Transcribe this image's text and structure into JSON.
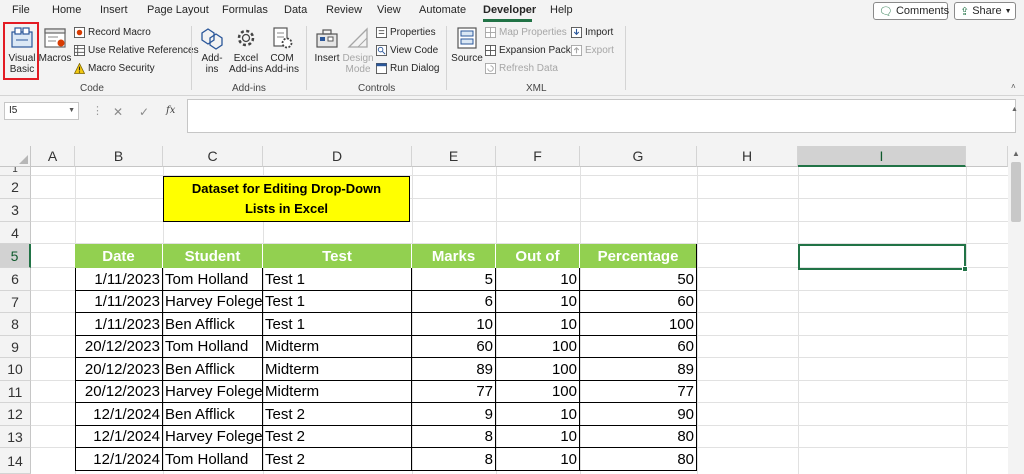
{
  "menu": {
    "tabs": [
      "File",
      "Home",
      "Insert",
      "Page Layout",
      "Formulas",
      "Data",
      "Review",
      "View",
      "Automate",
      "Developer",
      "Help"
    ],
    "active_tab": "Developer",
    "comments_label": "Comments",
    "share_label": "Share"
  },
  "ribbon": {
    "code": {
      "visual_basic": "Visual Basic",
      "visual_basic_l1": "Visual",
      "visual_basic_l2": "Basic",
      "macros": "Macros",
      "record_macro": "Record Macro",
      "use_relative_references": "Use Relative References",
      "macro_security": "Macro Security",
      "group_label": "Code"
    },
    "addins": {
      "addins_l1": "Add-",
      "addins_l2": "ins",
      "excel_addins_l1": "Excel",
      "excel_addins_l2": "Add-ins",
      "com_addins_l1": "COM",
      "com_addins_l2": "Add-ins",
      "group_label": "Add-ins"
    },
    "controls": {
      "insert": "Insert",
      "design_mode_l1": "Design",
      "design_mode_l2": "Mode",
      "properties": "Properties",
      "view_code": "View Code",
      "run_dialog": "Run Dialog",
      "group_label": "Controls"
    },
    "xml": {
      "source": "Source",
      "map_properties": "Map Properties",
      "expansion_packs": "Expansion Packs",
      "refresh_data": "Refresh Data",
      "import": "Import",
      "export": "Export",
      "group_label": "XML"
    }
  },
  "formula_bar": {
    "name_box": "I5",
    "cancel_glyph": "✕",
    "enter_glyph": "✓",
    "fx_label": "fx",
    "formula": ""
  },
  "sheet": {
    "columns": [
      "A",
      "B",
      "C",
      "D",
      "E",
      "F",
      "G",
      "H",
      "I"
    ],
    "selected_column": "I",
    "rows": [
      "1",
      "2",
      "3",
      "4",
      "5",
      "6",
      "7",
      "8",
      "9",
      "10",
      "11",
      "12",
      "13",
      "14"
    ],
    "selected_row": "5",
    "title_line1": "Dataset for Editing Drop-Down",
    "title_line2": "Lists in Excel",
    "table_headers": [
      "Date",
      "Student",
      "Test",
      "Marks",
      "Out of",
      "Percentage"
    ],
    "table_rows": [
      [
        "1/11/2023",
        "Tom Holland",
        "Test 1",
        "5",
        "10",
        "50"
      ],
      [
        "1/11/2023",
        "Harvey Folege",
        "Test 1",
        "6",
        "10",
        "60"
      ],
      [
        "1/11/2023",
        "Ben Afflick",
        "Test 1",
        "10",
        "10",
        "100"
      ],
      [
        "20/12/2023",
        "Tom Holland",
        "Midterm",
        "60",
        "100",
        "60"
      ],
      [
        "20/12/2023",
        "Ben Afflick",
        "Midterm",
        "89",
        "100",
        "89"
      ],
      [
        "20/12/2023",
        "Harvey Folege",
        "Midterm",
        "77",
        "100",
        "77"
      ],
      [
        "12/1/2024",
        "Ben Afflick",
        "Test 2",
        "9",
        "10",
        "90"
      ],
      [
        "12/1/2024",
        "Harvey Folege",
        "Test 2",
        "8",
        "10",
        "80"
      ],
      [
        "12/1/2024",
        "Tom Holland",
        "Test 2",
        "8",
        "10",
        "80"
      ]
    ]
  },
  "colors": {
    "accent": "#217346",
    "table_header": "#92d050",
    "title_fill": "#ffff00",
    "highlight_box": "#e31b23"
  }
}
